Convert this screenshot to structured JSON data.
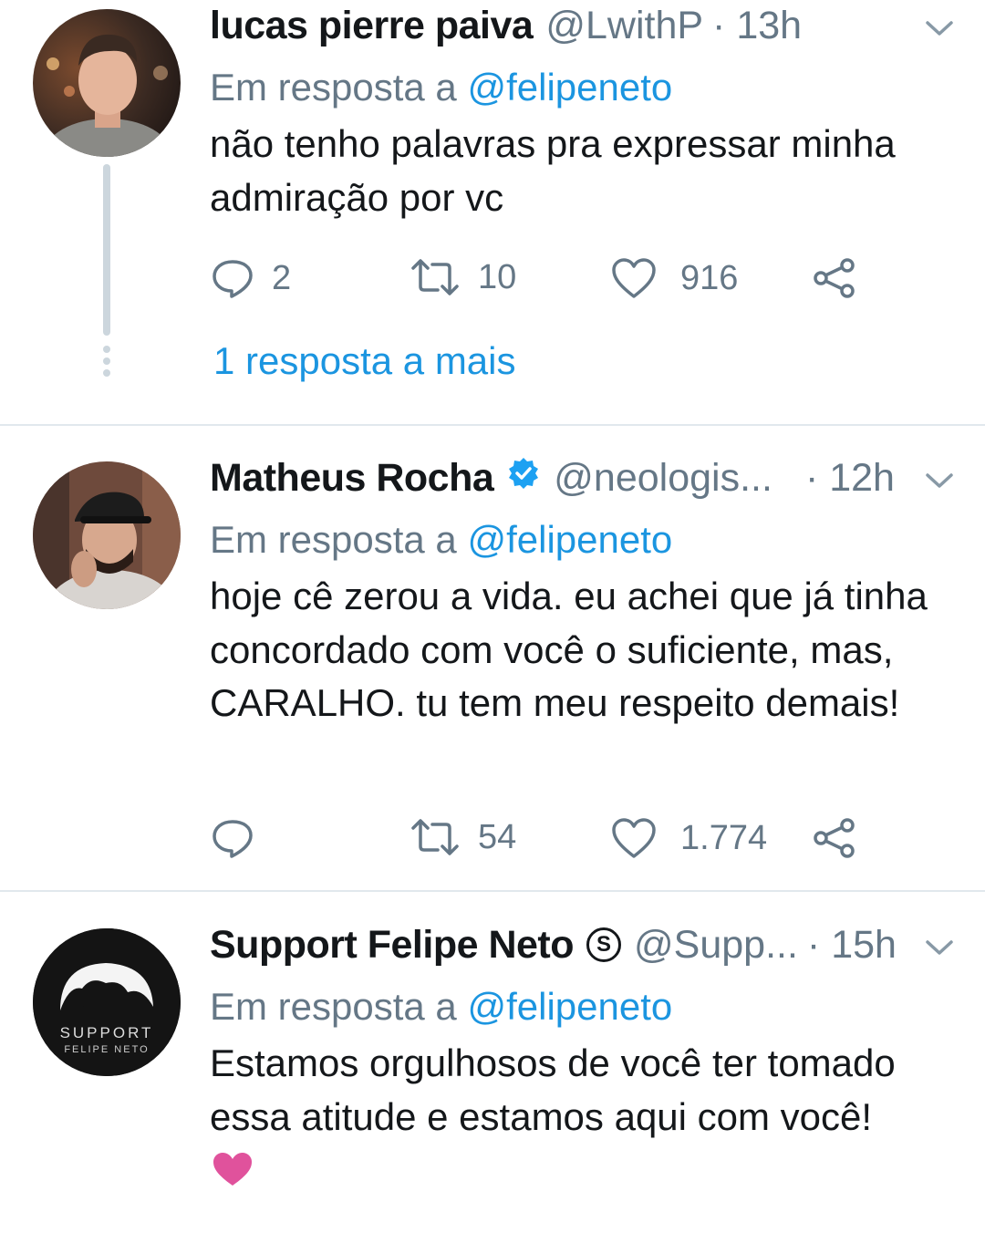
{
  "tweets": [
    {
      "name": "lucas pierre paiva",
      "handle": "@LwithP",
      "time": "· 13h",
      "reply_prefix": "Em resposta a",
      "reply_to": "@felipeneto",
      "text": "não tenho palavras pra expressar minha admiração por vc",
      "replies": "2",
      "retweets": "10",
      "likes": "916",
      "more_replies": "1 resposta a mais"
    },
    {
      "name": "Matheus Rocha",
      "handle": "@neologis...",
      "time": "· 12h",
      "reply_prefix": "Em resposta a",
      "reply_to": "@felipeneto",
      "text": "hoje cê zerou a vida. eu achei que já tinha concordado com você o suficiente, mas, CARALHO. tu tem meu respeito demais!",
      "replies": "",
      "retweets": "54",
      "likes": "1.774"
    },
    {
      "name": "Support Felipe Neto",
      "badge": "S",
      "handle": "@Supp...",
      "time": "· 15h",
      "reply_prefix": "Em resposta a",
      "reply_to": "@felipeneto",
      "text": "Estamos orgulhosos de você ter tomado essa atitude e estamos aqui com você!",
      "avatar_text": [
        "SUPPORT",
        "FELIPE NETO"
      ]
    }
  ],
  "colors": {
    "link": "#1b95e0",
    "muted": "#657786",
    "text": "#14171a",
    "divider": "#e1e8ed",
    "verified": "#1da1f2",
    "heart_emoji": "#e0529c"
  },
  "icons": [
    "reply-icon",
    "retweet-icon",
    "like-icon",
    "share-icon",
    "chevron-down-icon",
    "verified-icon",
    "heart-emoji"
  ]
}
